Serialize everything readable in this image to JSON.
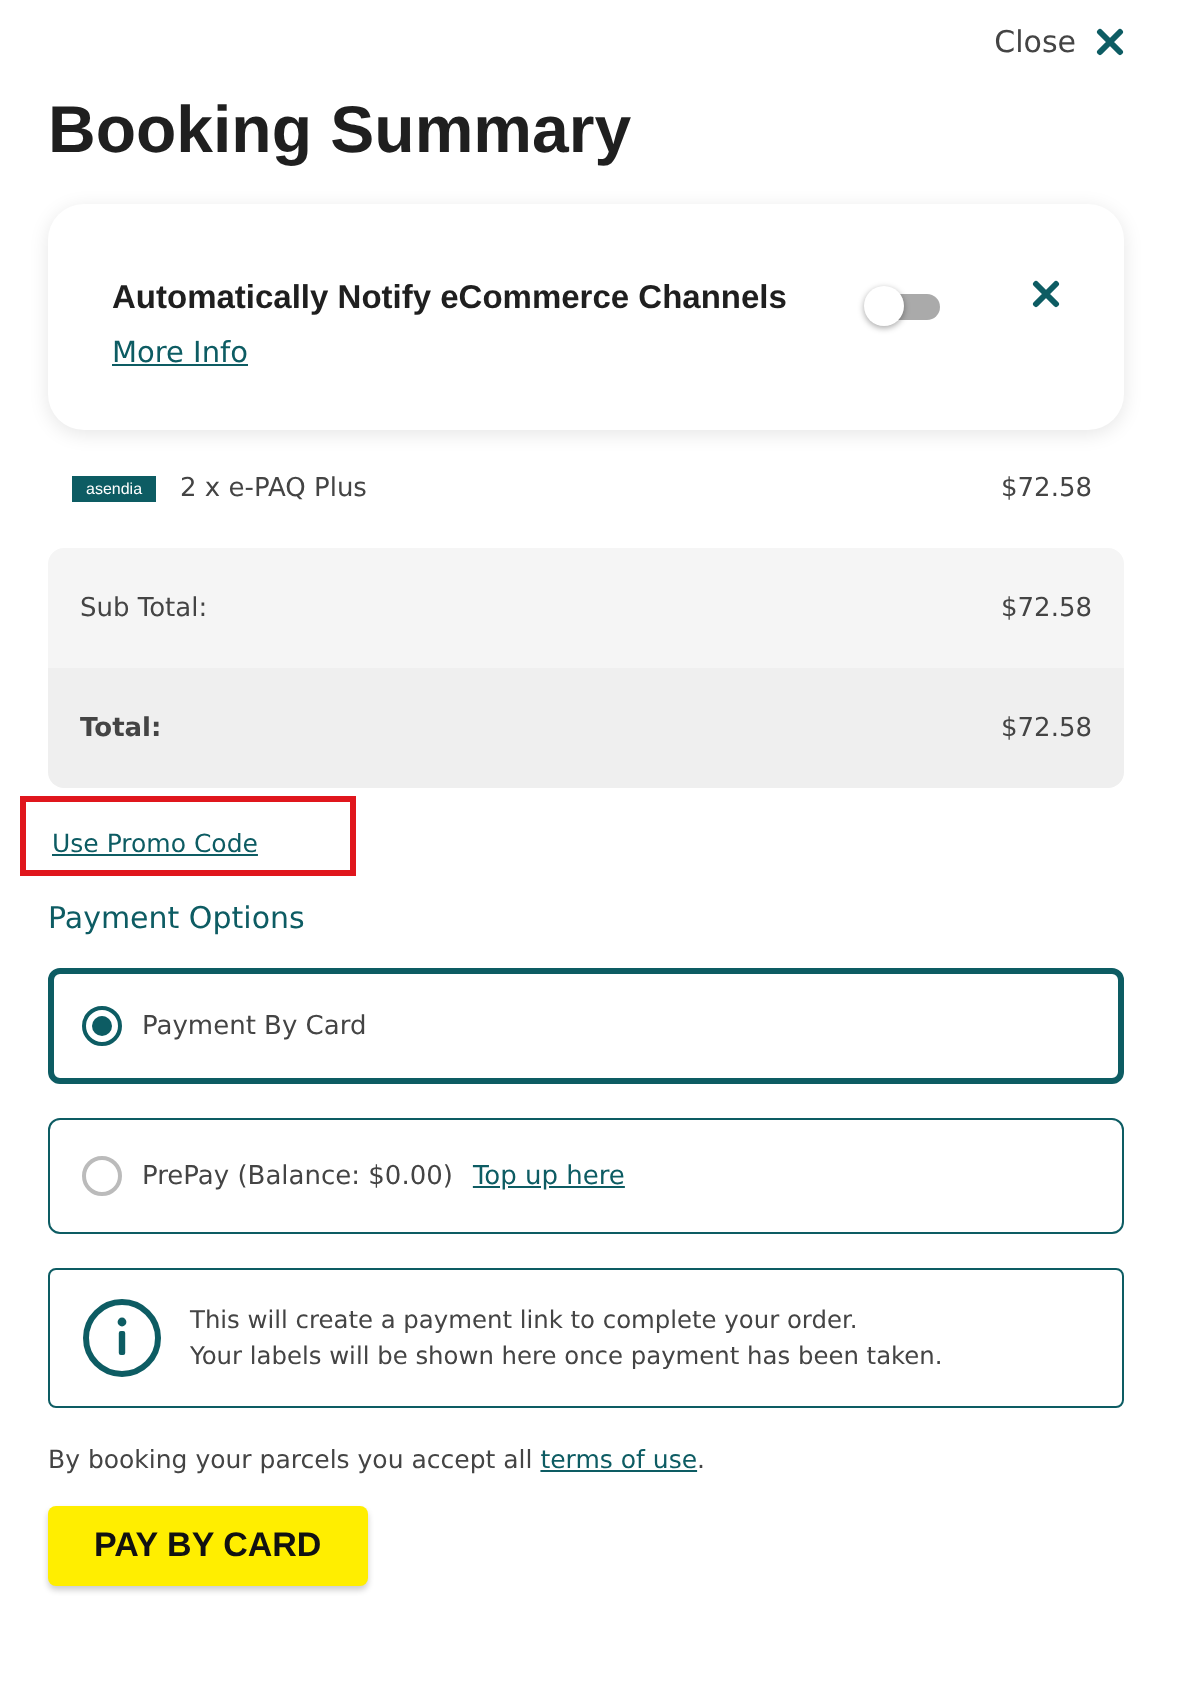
{
  "close": {
    "label": "Close"
  },
  "title": "Booking Summary",
  "notify_card": {
    "title": "Automatically Notify eCommerce Channels",
    "link": "More Info",
    "on": false
  },
  "items": [
    {
      "logo": "asendia",
      "description": "2 x e-PAQ Plus",
      "price": "$72.58"
    }
  ],
  "totals": [
    {
      "kind": "subtotal",
      "label": "Sub Total:",
      "value": "$72.58"
    },
    {
      "kind": "total",
      "label": "Total:",
      "value": "$72.58"
    }
  ],
  "promo": {
    "label": "Use Promo Code",
    "highlighted": true
  },
  "payment_heading": "Payment Options",
  "payment_options": [
    {
      "label": "Payment By Card",
      "selected": true
    },
    {
      "label": "PrePay (Balance: $0.00)",
      "link": "Top up here",
      "selected": false
    }
  ],
  "info": {
    "lines": [
      "This will create a payment link to complete your order.",
      "Your labels will be shown here once payment has been taken."
    ]
  },
  "terms": {
    "text": "By booking your parcels you accept all ",
    "link": "terms of use",
    "after": "."
  },
  "pay_button": "PAY BY CARD"
}
